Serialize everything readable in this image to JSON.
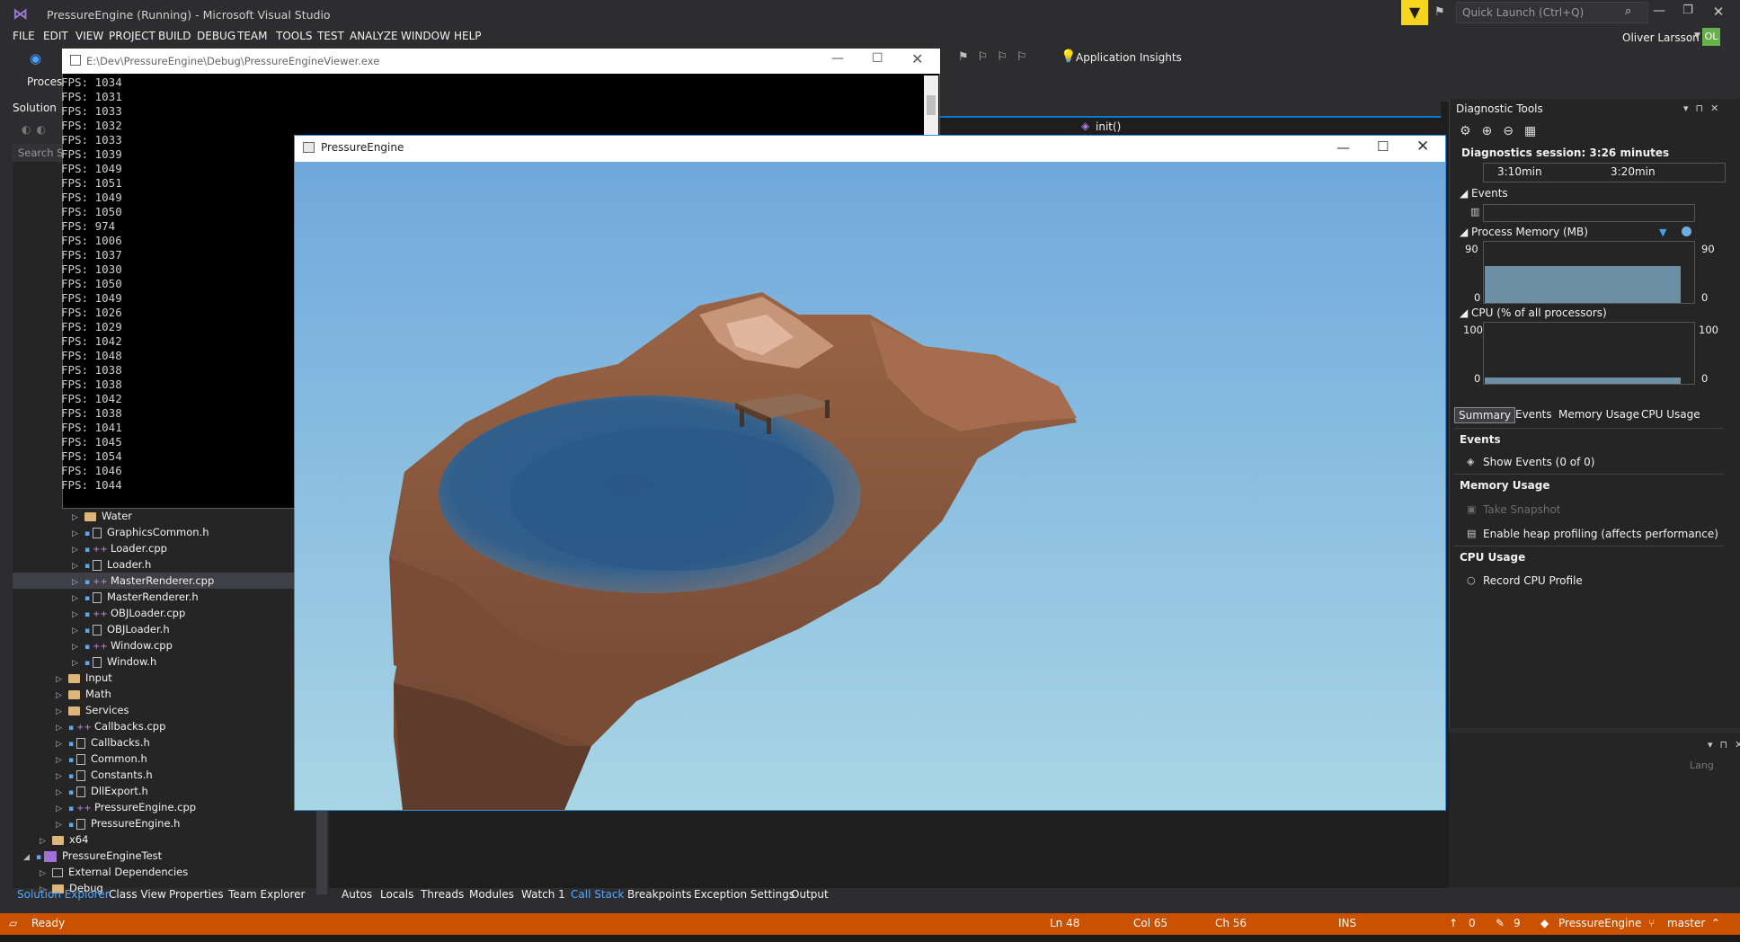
{
  "window": {
    "title": "PressureEngine (Running) - Microsoft Visual Studio",
    "quick_launch_placeholder": "Quick Launch (Ctrl+Q)",
    "user": "Oliver Larsson",
    "user_initials": "OL"
  },
  "menu": [
    "FILE",
    "EDIT",
    "VIEW",
    "PROJECT",
    "BUILD",
    "DEBUG",
    "TEAM",
    "TOOLS",
    "TEST",
    "ANALYZE",
    "WINDOW",
    "HELP"
  ],
  "toolbar": {
    "app_insights": "Application Insights",
    "process_label": "Proces"
  },
  "solution_explorer": {
    "title": "Solution",
    "search_placeholder": "Search So",
    "tree": [
      {
        "label": "Water",
        "kind": "folder",
        "indent": 3
      },
      {
        "label": "GraphicsCommon.h",
        "kind": "h",
        "indent": 3
      },
      {
        "label": "Loader.cpp",
        "kind": "cpp",
        "indent": 3
      },
      {
        "label": "Loader.h",
        "kind": "h",
        "indent": 3
      },
      {
        "label": "MasterRenderer.cpp",
        "kind": "cpp",
        "indent": 3,
        "selected": true
      },
      {
        "label": "MasterRenderer.h",
        "kind": "h",
        "indent": 3
      },
      {
        "label": "OBJLoader.cpp",
        "kind": "cpp",
        "indent": 3
      },
      {
        "label": "OBJLoader.h",
        "kind": "h",
        "indent": 3
      },
      {
        "label": "Window.cpp",
        "kind": "cpp",
        "indent": 3
      },
      {
        "label": "Window.h",
        "kind": "h",
        "indent": 3
      },
      {
        "label": "Input",
        "kind": "folder",
        "indent": 2
      },
      {
        "label": "Math",
        "kind": "folder",
        "indent": 2
      },
      {
        "label": "Services",
        "kind": "folder",
        "indent": 2
      },
      {
        "label": "Callbacks.cpp",
        "kind": "cpp",
        "indent": 2
      },
      {
        "label": "Callbacks.h",
        "kind": "h",
        "indent": 2
      },
      {
        "label": "Common.h",
        "kind": "h",
        "indent": 2
      },
      {
        "label": "Constants.h",
        "kind": "h",
        "indent": 2
      },
      {
        "label": "DllExport.h",
        "kind": "h",
        "indent": 2
      },
      {
        "label": "PressureEngine.cpp",
        "kind": "cpp",
        "indent": 2
      },
      {
        "label": "PressureEngine.h",
        "kind": "h",
        "indent": 2
      },
      {
        "label": "x64",
        "kind": "folder",
        "indent": 1
      },
      {
        "label": "PressureEngineTest",
        "kind": "proj",
        "indent": 0
      },
      {
        "label": "External Dependencies",
        "kind": "ref",
        "indent": 1
      },
      {
        "label": "Debug",
        "kind": "folder",
        "indent": 1
      }
    ]
  },
  "bottom_tabs_left": [
    "Solution Explorer",
    "Class View",
    "Properties",
    "Team Explorer"
  ],
  "bottom_tabs_mid": [
    "Autos",
    "Locals",
    "Threads",
    "Modules",
    "Watch 1",
    "Call Stack",
    "Breakpoints",
    "Exception Settings",
    "Output"
  ],
  "active_mid_tab": "Call Stack",
  "editor": {
    "function": "init()"
  },
  "console": {
    "path": "E:\\Dev\\PressureEngine\\Debug\\PressureEngineViewer.exe",
    "lines": [
      "FPS: 1034",
      "FPS: 1031",
      "FPS: 1033",
      "FPS: 1032",
      "FPS: 1033",
      "FPS: 1039",
      "FPS: 1049",
      "FPS: 1051",
      "FPS: 1049",
      "FPS: 1050",
      "FPS: 974",
      "FPS: 1006",
      "FPS: 1037",
      "FPS: 1030",
      "FPS: 1050",
      "FPS: 1049",
      "FPS: 1026",
      "FPS: 1029",
      "FPS: 1042",
      "FPS: 1048",
      "FPS: 1038",
      "FPS: 1038",
      "FPS: 1042",
      "FPS: 1038",
      "FPS: 1041",
      "FPS: 1045",
      "FPS: 1054",
      "FPS: 1046",
      "FPS: 1044"
    ]
  },
  "engine_window": {
    "title": "PressureEngine"
  },
  "diagnostics": {
    "title": "Diagnostic Tools",
    "session": "Diagnostics session: 3:26 minutes",
    "timeline_ticks": [
      "3:10min",
      "3:20min"
    ],
    "events_label": "Events",
    "memory_label": "Process Memory (MB)",
    "memory_max": "90",
    "memory_min": "0",
    "memory_level": 0.6,
    "cpu_label": "CPU (% of all processors)",
    "cpu_max": "100",
    "cpu_min": "0",
    "cpu_level": 0.1,
    "tabs": [
      "Summary",
      "Events",
      "Memory Usage",
      "CPU Usage"
    ],
    "summary": {
      "events_head": "Events",
      "show_events": "Show Events (0 of 0)",
      "memory_head": "Memory Usage",
      "take_snapshot": "Take Snapshot",
      "heap_profiling": "Enable heap profiling (affects performance)",
      "cpu_head": "CPU Usage",
      "record_cpu": "Record CPU Profile"
    }
  },
  "lower_right": {
    "lang": "Lang"
  },
  "status": {
    "ready": "Ready",
    "ln": "Ln 48",
    "col": "Col 65",
    "ch": "Ch 56",
    "ins": "INS",
    "up_count": "0",
    "edit_count": "9",
    "repo": "PressureEngine",
    "branch": "master"
  },
  "colors": {
    "accent": "#007acc",
    "status_bar": "#ca5100",
    "sky_top": "#6fa8dc",
    "sky_bottom": "#a9d6e5",
    "terrain": "#8a5a3e",
    "water": "#2f5f8f"
  }
}
